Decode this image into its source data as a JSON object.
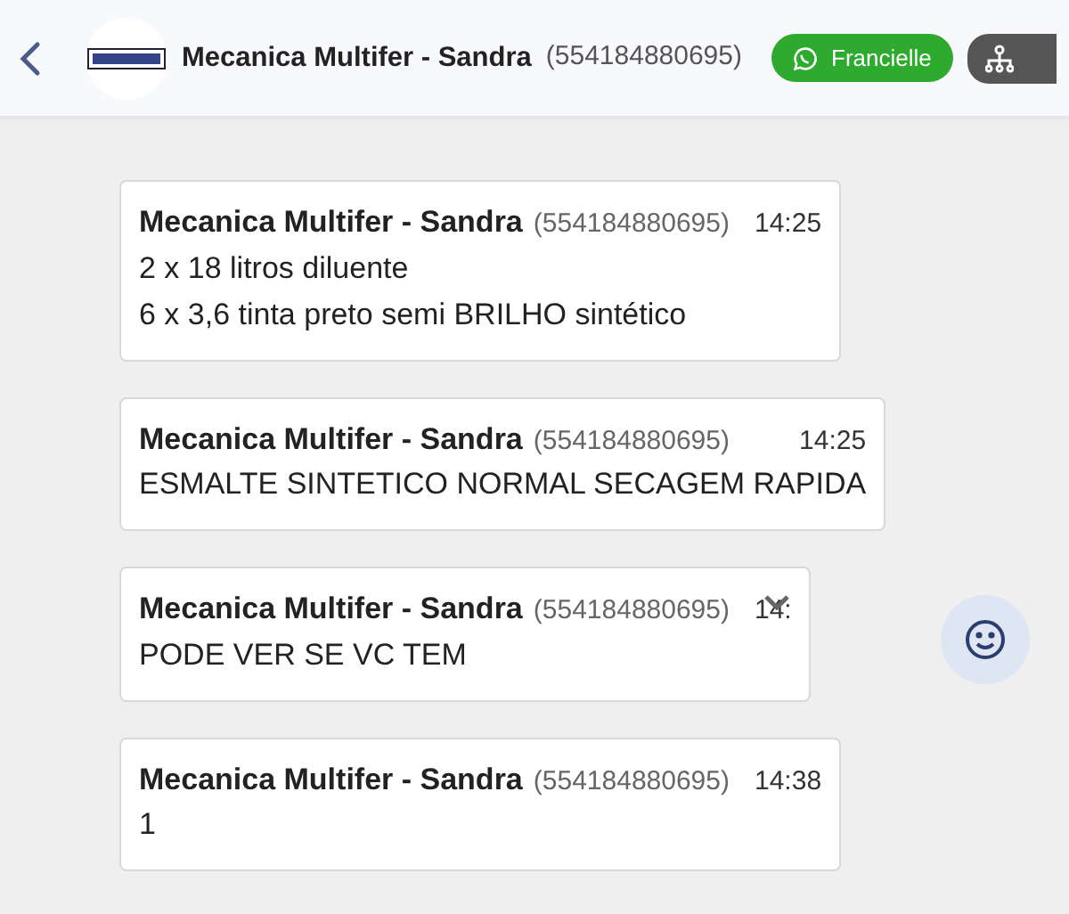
{
  "header": {
    "contact_name": "Mecanica Multifer - Sandra",
    "contact_phone": "(554184880695)",
    "agent_button": "Francielle"
  },
  "messages": [
    {
      "sender": "Mecanica Multifer - Sandra",
      "phone": "(554184880695)",
      "time": "14:25",
      "lines": [
        "2 x 18 litros diluente",
        "6 x 3,6 tinta preto semi BRILHO sintético"
      ],
      "hovered": false
    },
    {
      "sender": "Mecanica Multifer - Sandra",
      "phone": "(554184880695)",
      "time": "14:25",
      "lines": [
        "ESMALTE SINTETICO NORMAL SECAGEM RAPIDA"
      ],
      "hovered": false
    },
    {
      "sender": "Mecanica Multifer - Sandra",
      "phone": "(554184880695)",
      "time": "14:",
      "lines": [
        "PODE VER SE VC TEM"
      ],
      "hovered": true
    },
    {
      "sender": "Mecanica Multifer - Sandra",
      "phone": "(554184880695)",
      "time": "14:38",
      "lines": [
        "1"
      ],
      "hovered": false
    }
  ]
}
